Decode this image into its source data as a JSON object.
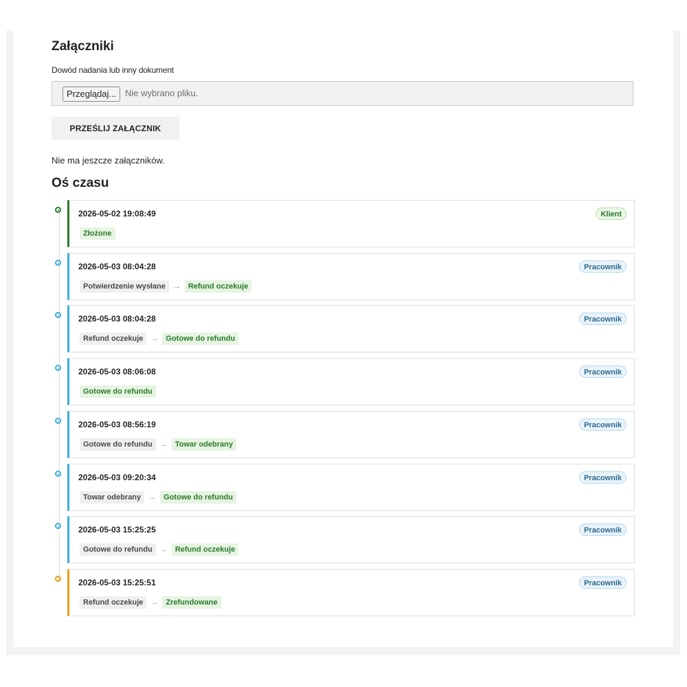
{
  "colors": {
    "green": "#2b7a2b",
    "blue": "#3aaed8",
    "orange": "#e8a01a"
  },
  "attachments": {
    "title": "Załączniki",
    "field_label": "Dowód nadania lub inny dokument",
    "browse_label": "Przeglądaj...",
    "no_file_text": "Nie wybrano pliku.",
    "upload_label": "PRZEŚLIJ ZAŁĄCZNIK",
    "empty_text": "Nie ma jeszcze załączników."
  },
  "timeline": {
    "title": "Oś czasu",
    "entries": [
      {
        "time": "2026-05-02 19:08:49",
        "actor": "Klient",
        "actor_type": "klient",
        "accent": "green",
        "from": "",
        "to": "Złożone"
      },
      {
        "time": "2026-05-03 08:04:28",
        "actor": "Pracownik",
        "actor_type": "pracownik",
        "accent": "blue",
        "from": "Potwierdzenie wysłane",
        "to": "Refund oczekuje"
      },
      {
        "time": "2026-05-03 08:04:28",
        "actor": "Pracownik",
        "actor_type": "pracownik",
        "accent": "blue",
        "from": "Refund oczekuje",
        "to": "Gotowe do refundu"
      },
      {
        "time": "2026-05-03 08:06:08",
        "actor": "Pracownik",
        "actor_type": "pracownik",
        "accent": "blue",
        "from": "",
        "to": "Gotowe do refundu"
      },
      {
        "time": "2026-05-03 08:56:19",
        "actor": "Pracownik",
        "actor_type": "pracownik",
        "accent": "blue",
        "from": "Gotowe do refundu",
        "to": "Towar odebrany"
      },
      {
        "time": "2026-05-03 09:20:34",
        "actor": "Pracownik",
        "actor_type": "pracownik",
        "accent": "blue",
        "from": "Towar odebrany",
        "to": "Gotowe do refundu"
      },
      {
        "time": "2026-05-03 15:25:25",
        "actor": "Pracownik",
        "actor_type": "pracownik",
        "accent": "blue",
        "from": "Gotowe do refundu",
        "to": "Refund oczekuje"
      },
      {
        "time": "2026-05-03 15:25:51",
        "actor": "Pracownik",
        "actor_type": "pracownik",
        "accent": "orange",
        "from": "Refund oczekuje",
        "to": "Zrefundowane"
      }
    ]
  }
}
